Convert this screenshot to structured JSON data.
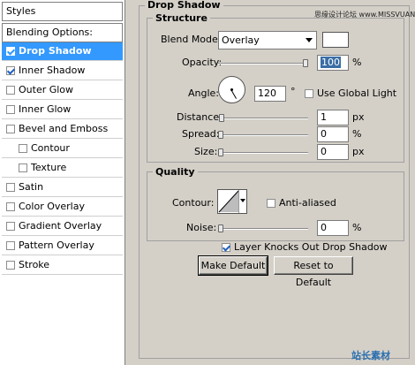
{
  "styles_panel": {
    "header": "Styles",
    "blending_options": "Blending Options: Custom",
    "items": [
      {
        "label": "Drop Shadow",
        "checked": true,
        "selected": true
      },
      {
        "label": "Inner Shadow",
        "checked": true
      },
      {
        "label": "Outer Glow",
        "checked": false
      },
      {
        "label": "Inner Glow",
        "checked": false
      },
      {
        "label": "Bevel and Emboss",
        "checked": false
      },
      {
        "label": "Contour",
        "checked": false,
        "sub": true
      },
      {
        "label": "Texture",
        "checked": false,
        "sub": true
      },
      {
        "label": "Satin",
        "checked": false
      },
      {
        "label": "Color Overlay",
        "checked": false
      },
      {
        "label": "Gradient Overlay",
        "checked": false
      },
      {
        "label": "Pattern Overlay",
        "checked": false
      },
      {
        "label": "Stroke",
        "checked": false
      }
    ]
  },
  "drop_shadow": {
    "title": "Drop Shadow",
    "structure": {
      "title": "Structure",
      "blend_mode_label": "Blend Mode:",
      "blend_mode_value": "Overlay",
      "shadow_color": "#ffffff",
      "opacity_label": "Opacity:",
      "opacity_value": "100",
      "opacity_unit": "%",
      "opacity_level": 1.0,
      "angle_label": "Angle:",
      "angle_value": "120",
      "angle_unit": "°",
      "use_global_light_label": "Use Global Light",
      "use_global_light_checked": false,
      "distance_label": "Distance:",
      "distance_value": "1",
      "distance_unit": "px",
      "spread_label": "Spread:",
      "spread_value": "0",
      "spread_unit": "%",
      "size_label": "Size:",
      "size_value": "0",
      "size_unit": "px"
    },
    "quality": {
      "title": "Quality",
      "contour_label": "Contour:",
      "anti_aliased_label": "Anti-aliased",
      "anti_aliased_checked": false,
      "noise_label": "Noise:",
      "noise_value": "0",
      "noise_unit": "%"
    },
    "knocks_out_label": "Layer Knocks Out Drop Shadow",
    "knocks_out_checked": true,
    "make_default_label": "Make Default",
    "reset_default_label": "Reset to Default"
  },
  "watermark_top": "思缘设计论坛 www.MISSVUAN.com",
  "watermark_bottom": "站长素材"
}
